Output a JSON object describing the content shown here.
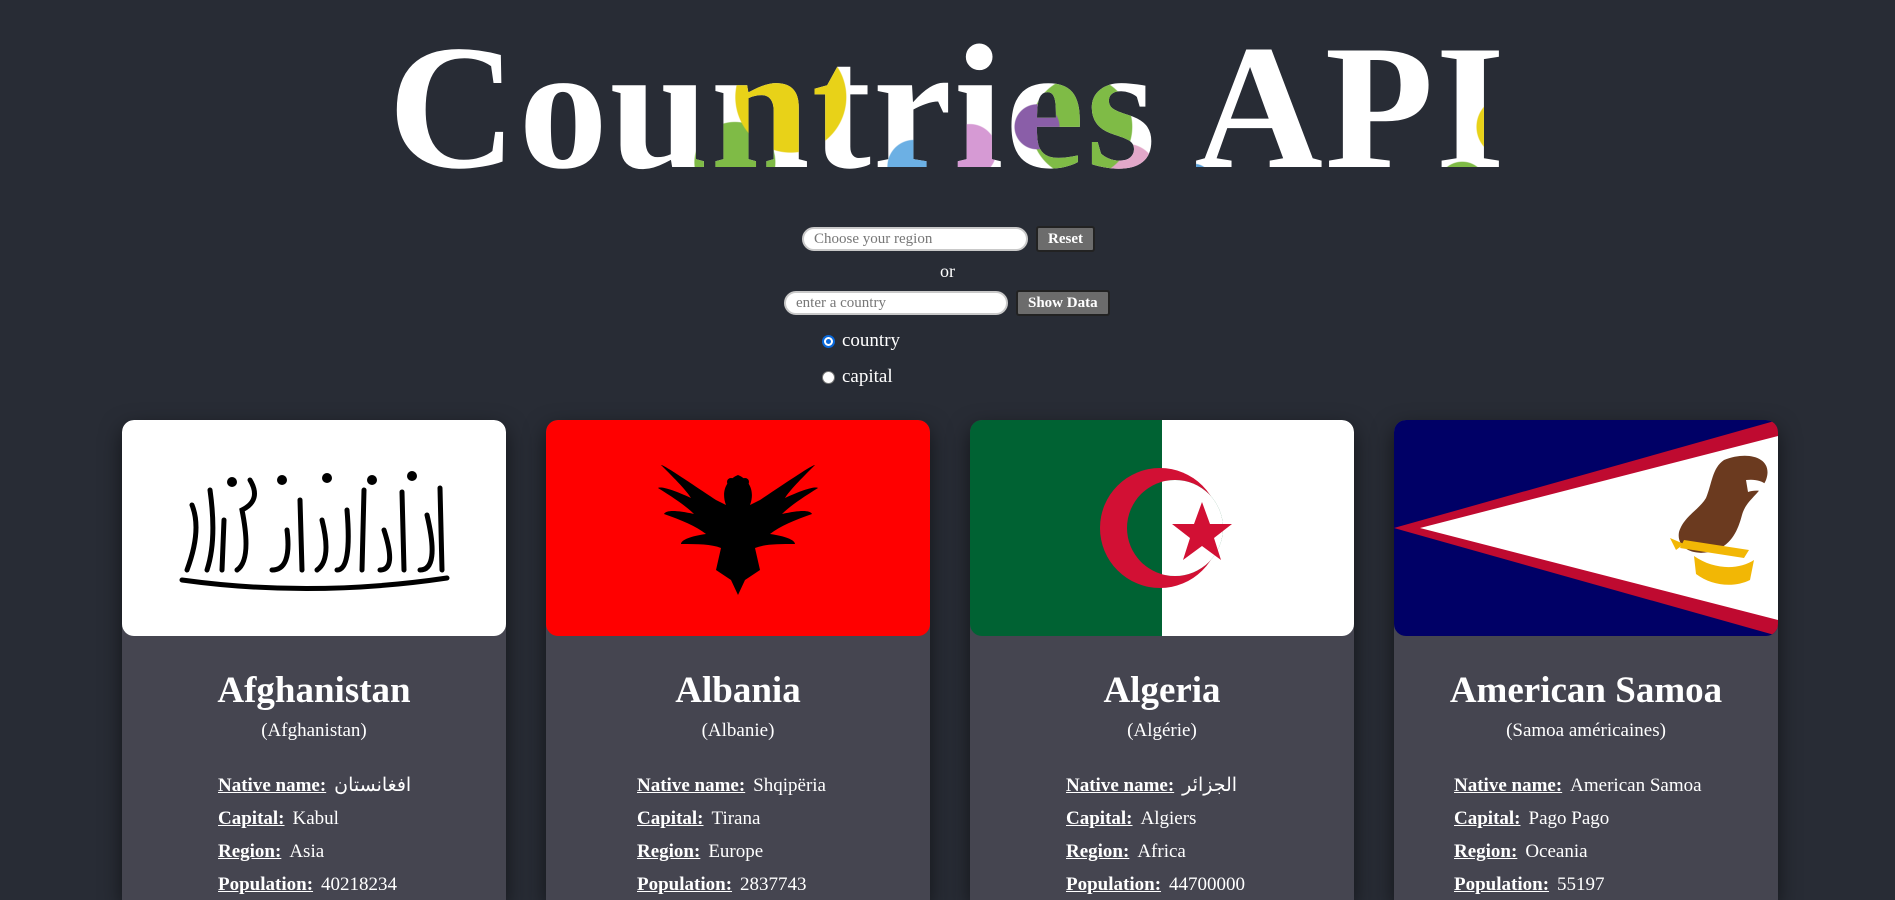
{
  "header": {
    "title": "Countries API"
  },
  "controls": {
    "region_placeholder": "Choose your region",
    "reset_label": "Reset",
    "or_text": "or",
    "country_placeholder": "enter a country",
    "show_label": "Show Data",
    "radio_country": "country",
    "radio_capital": "capital",
    "selected_radio": "country"
  },
  "labels": {
    "native": "Native name:",
    "capital": "Capital:",
    "region": "Region:",
    "population": "Population:"
  },
  "cards": [
    {
      "name": "Afghanistan",
      "native_paren": "(Afghanistan)",
      "native_name": "افغانستان",
      "capital": "Kabul",
      "region": "Asia",
      "population": "40218234",
      "flag_icon": "afghanistan-flag"
    },
    {
      "name": "Albania",
      "native_paren": "(Albanie)",
      "native_name": "Shqipëria",
      "capital": "Tirana",
      "region": "Europe",
      "population": "2837743",
      "flag_icon": "albania-flag"
    },
    {
      "name": "Algeria",
      "native_paren": "(Algérie)",
      "native_name": "الجزائر",
      "capital": "Algiers",
      "region": "Africa",
      "population": "44700000",
      "flag_icon": "algeria-flag"
    },
    {
      "name": "American Samoa",
      "native_paren": "(Samoa américaines)",
      "native_name": "American Samoa",
      "capital": "Pago Pago",
      "region": "Oceania",
      "population": "55197",
      "flag_icon": "american-samoa-flag"
    }
  ],
  "colors": {
    "background": "#282c35",
    "card": "#454550",
    "button": "#6c6c6c",
    "albania_red": "#ff0000",
    "algeria_green": "#006233",
    "algeria_red": "#d21034",
    "samoa_blue": "#000066",
    "samoa_red": "#bf0a30"
  }
}
